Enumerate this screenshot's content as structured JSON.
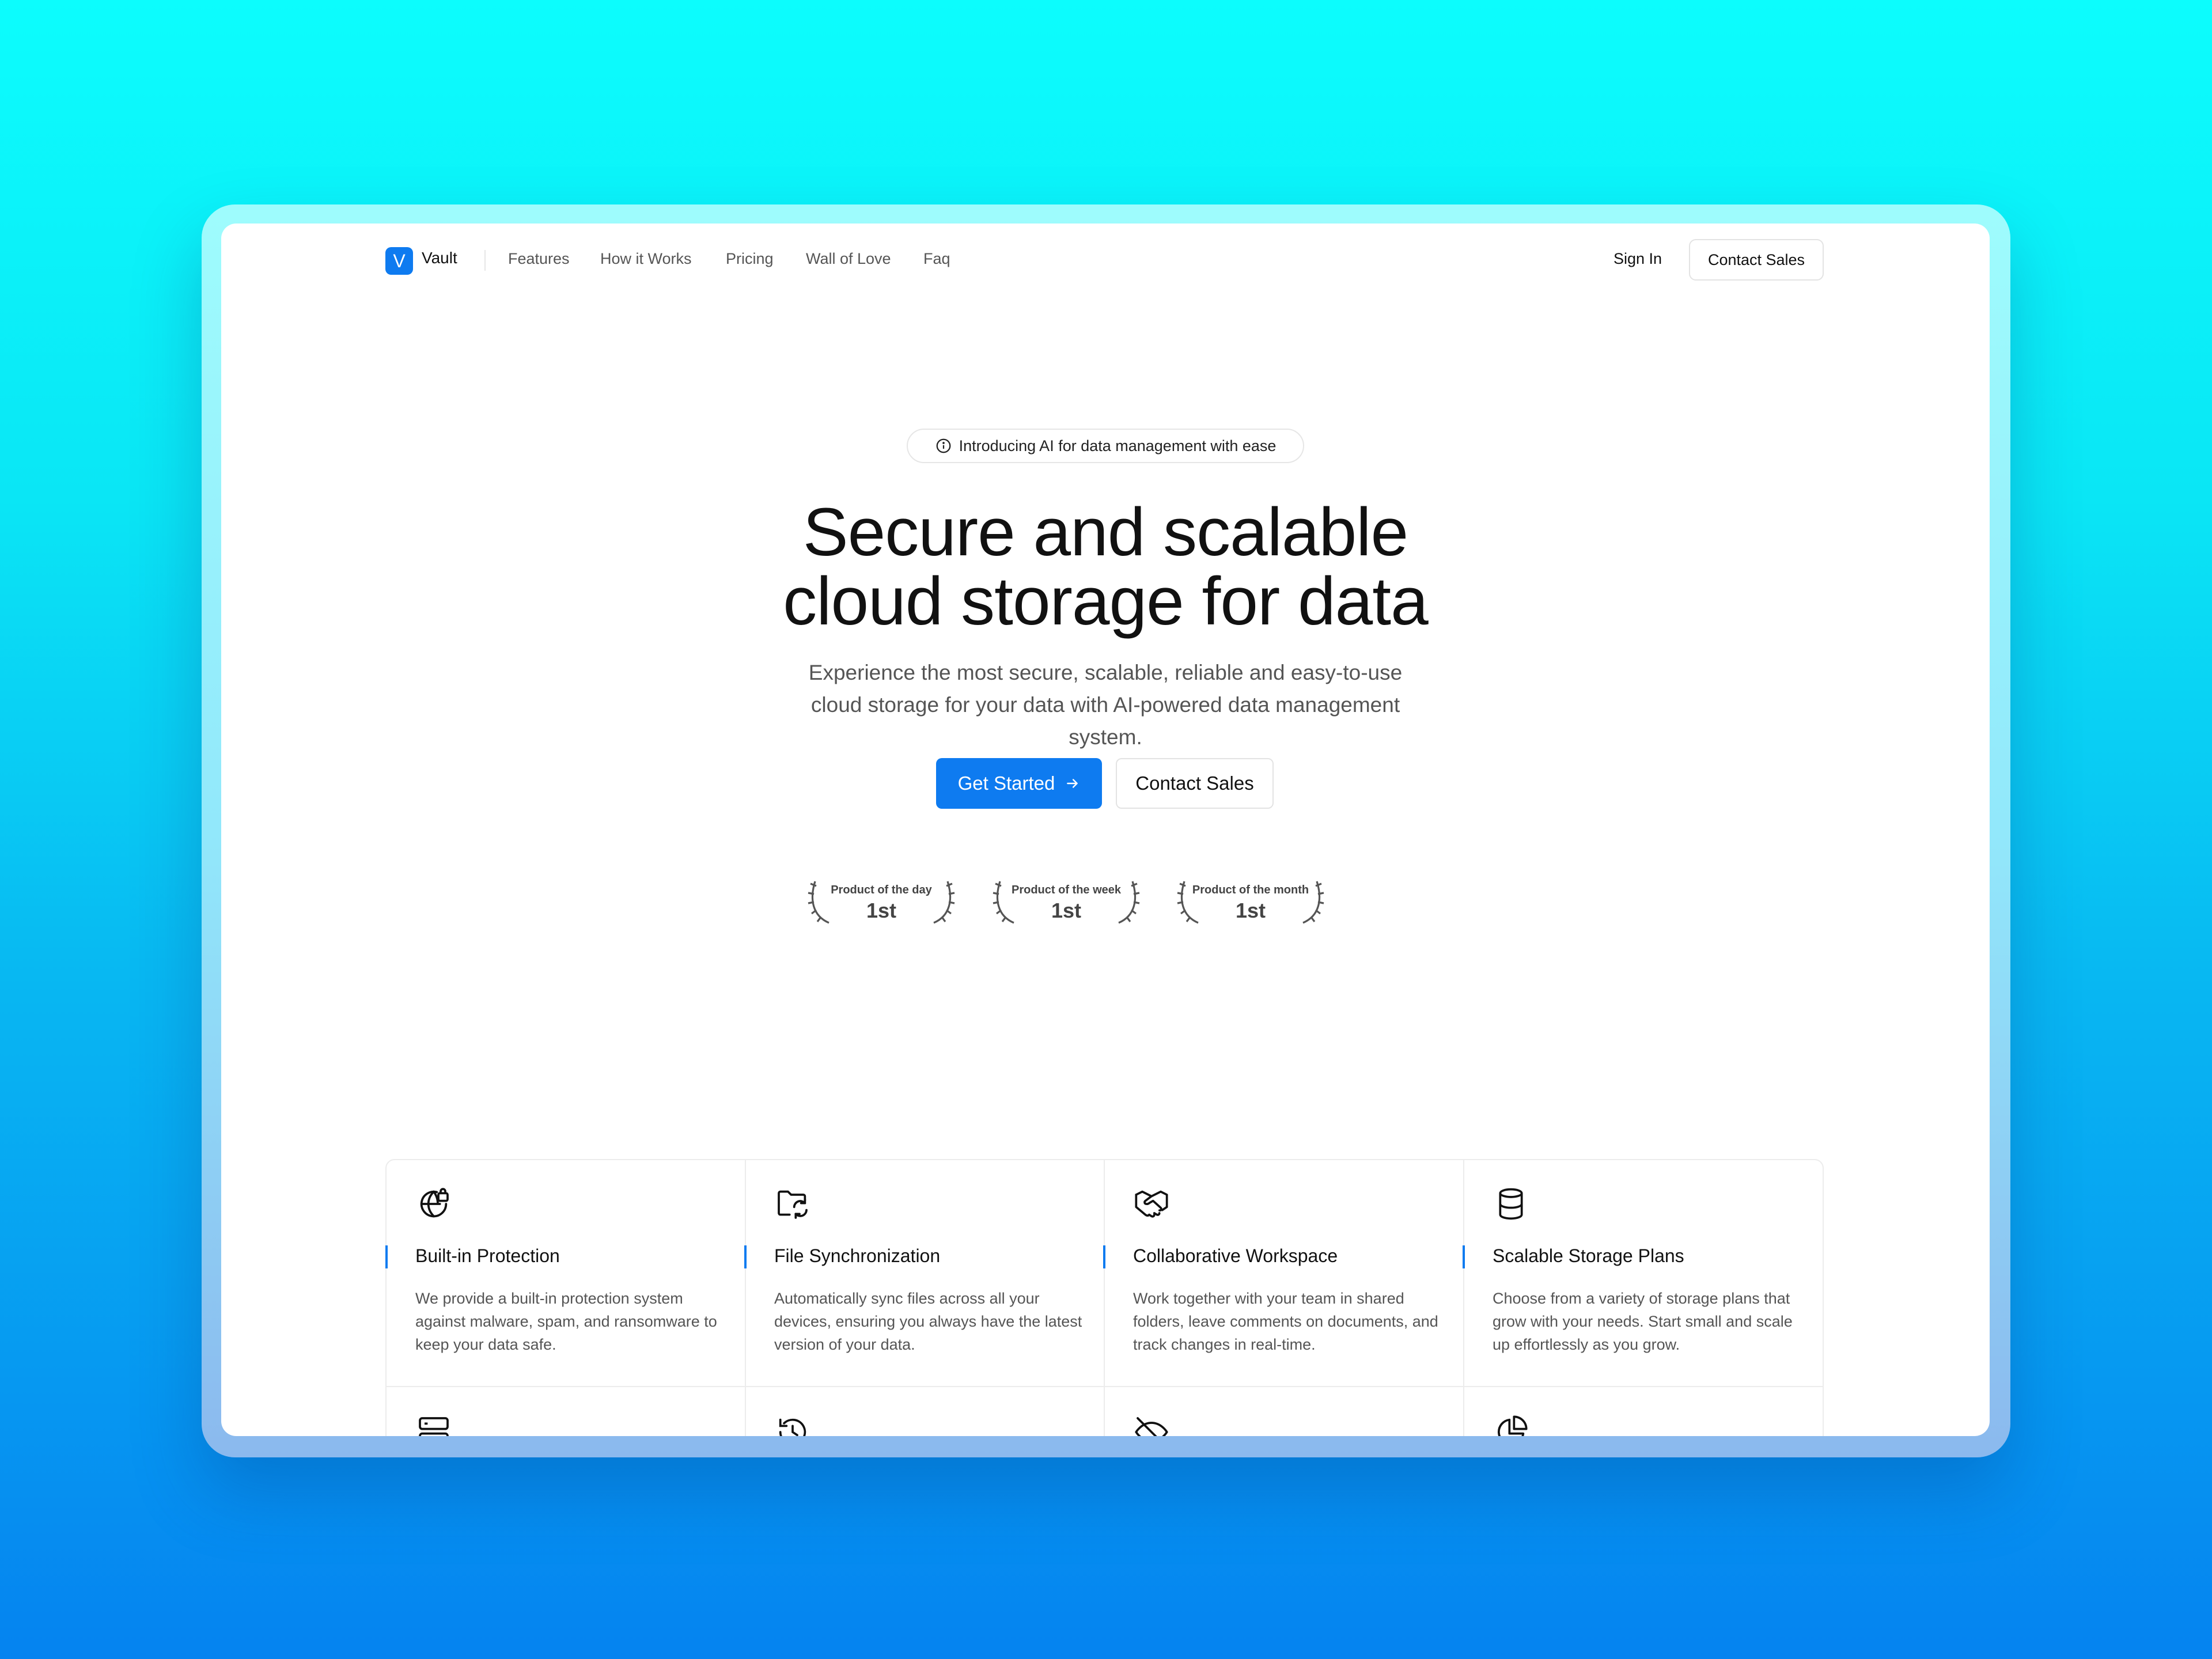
{
  "nav": {
    "logo_letter": "V",
    "brand": "Vault",
    "links": [
      "Features",
      "How it Works",
      "Pricing",
      "Wall of Love",
      "Faq"
    ],
    "sign_in": "Sign In",
    "contact": "Contact Sales"
  },
  "hero": {
    "badge": "Introducing AI for data management with ease",
    "title_line1": "Secure and scalable",
    "title_line2": "cloud storage for data",
    "subtitle": "Experience the most secure, scalable, reliable and easy-to-use cloud storage for your data with AI-powered data management system.",
    "primary_button": "Get Started",
    "secondary_button": "Contact Sales"
  },
  "awards": [
    {
      "title": "Product of the day",
      "rank": "1st"
    },
    {
      "title": "Product of the week",
      "rank": "1st"
    },
    {
      "title": "Product of the month",
      "rank": "1st"
    }
  ],
  "features": [
    {
      "icon": "globe-lock-icon",
      "title": "Built-in Protection",
      "description": "We provide a built-in protection system against malware, spam, and ransomware to keep your data safe."
    },
    {
      "icon": "folder-sync-icon",
      "title": "File Synchronization",
      "description": "Automatically sync files across all your devices, ensuring you always have the latest version of your data."
    },
    {
      "icon": "handshake-icon",
      "title": "Collaborative Workspace",
      "description": "Work together with your team in shared folders, leave comments on documents, and track changes in real-time."
    },
    {
      "icon": "database-icon",
      "title": "Scalable Storage Plans",
      "description": "Choose from a variety of storage plans that grow with your needs. Start small and scale up effortlessly as you grow."
    }
  ],
  "second_row_icons": [
    "server-icon",
    "history-icon",
    "eye-off-icon",
    "pie-chart-icon"
  ],
  "colors": {
    "accent": "#0e7bf0",
    "background_top": "#0cfdfd",
    "background_bottom": "#0583f0"
  }
}
